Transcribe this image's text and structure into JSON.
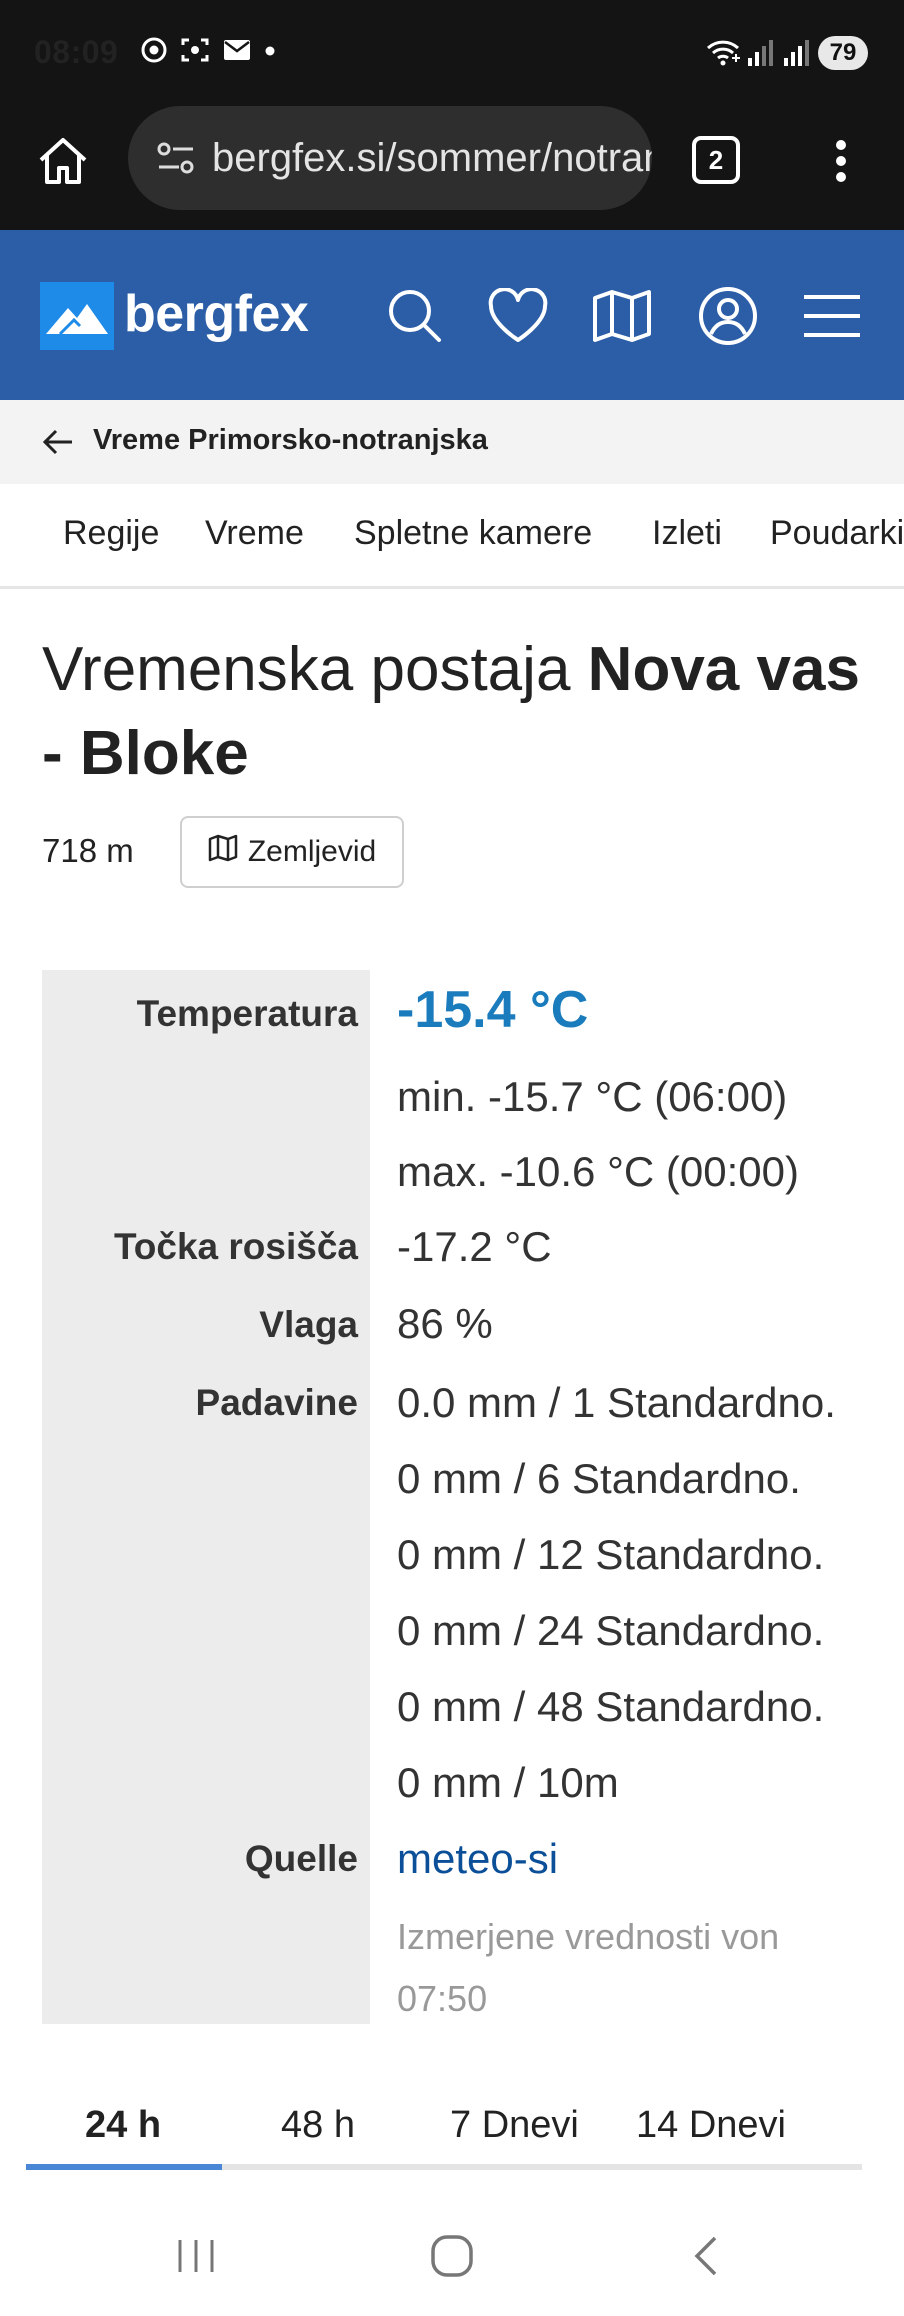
{
  "status_bar": {
    "time": "08:09",
    "battery": "79"
  },
  "browser": {
    "url": "bergfex.si/sommer/notranjska/wetter/",
    "tab_count": "2"
  },
  "site": {
    "logo_text": "bergfex",
    "brand_color": "#2b5ea7"
  },
  "breadcrumb": {
    "label": "Vreme Primorsko-notranjska"
  },
  "nav": {
    "items": [
      "Regije",
      "Vreme",
      "Spletne kamere",
      "Izleti",
      "Poudarki"
    ]
  },
  "station": {
    "title_prefix": "Vremenska postaja",
    "title_name": "Nova vas - Bloke",
    "elevation": "718 m",
    "map_button": "Zemljevid"
  },
  "measurements": {
    "temperature_label": "Temperatura",
    "temperature": "-15.4 °C",
    "temp_min": "min. -15.7 °C (06:00)",
    "temp_max": "max. -10.6 °C (00:00)",
    "dewpoint_label": "Točka rosišča",
    "dewpoint": "-17.2 °C",
    "humidity_label": "Vlaga",
    "humidity": "86 %",
    "precip_label": "Padavine",
    "precip": [
      "0.0 mm / 1 Standardno.",
      "0 mm / 6 Standardno.",
      "0 mm / 12 Standardno.",
      "0 mm / 24 Standardno.",
      "0 mm / 48 Standardno.",
      "0 mm / 10m"
    ],
    "source_label": "Quelle",
    "source": "meteo-si",
    "measured_note_1": "Izmerjene vrednosti von",
    "measured_note_2": "07:50"
  },
  "period_tabs": {
    "items": [
      "24 h",
      "48 h",
      "7 Dnevi",
      "14 Dnevi"
    ],
    "active": "24 h"
  }
}
